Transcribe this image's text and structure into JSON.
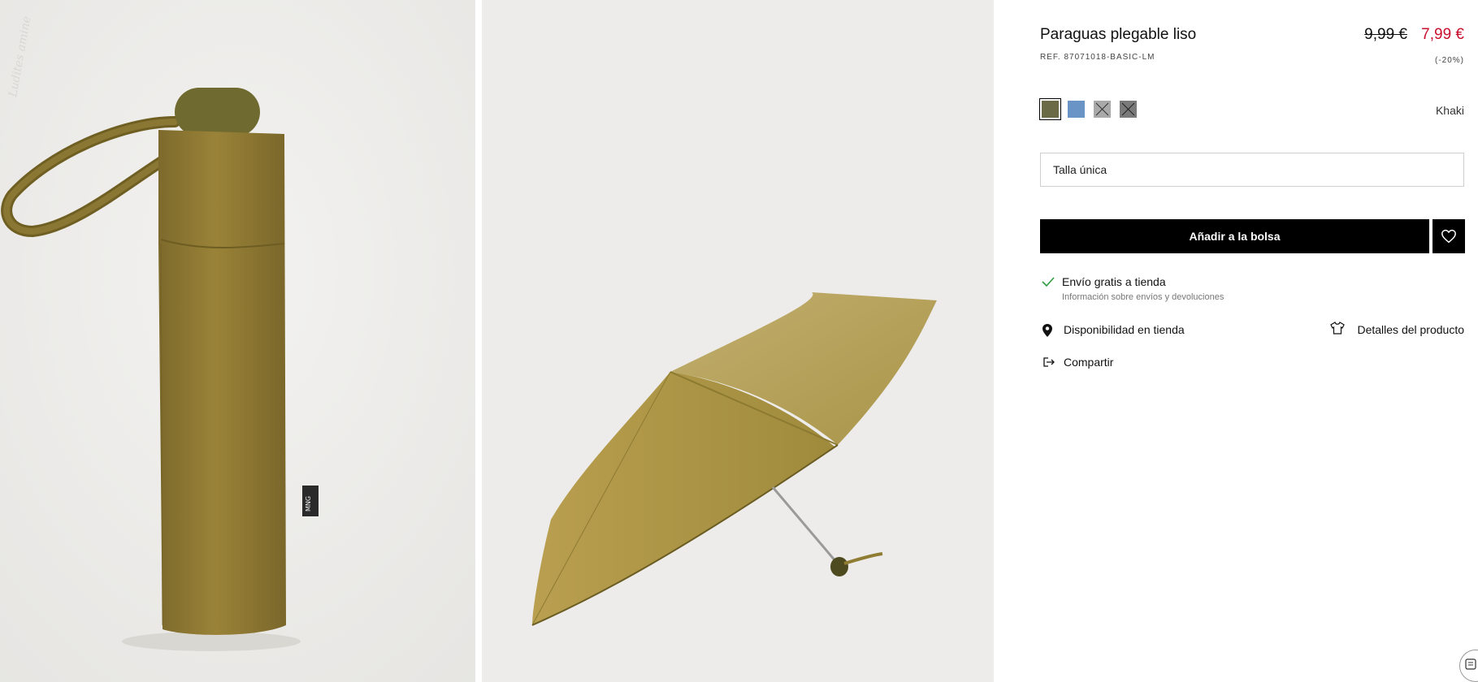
{
  "product": {
    "title": "Paraguas plegable liso",
    "ref": "REF. 87071018-BASIC-LM",
    "price_old": "9,99 €",
    "price_new": "7,99 €",
    "discount": "(-20%)",
    "selected_color": "Khaki"
  },
  "colors": {
    "swatches": [
      "#6b6a47",
      "#6a93c6",
      "#a9a9a9",
      "#7a7a7a"
    ],
    "accent_red": "#c8102e"
  },
  "size": {
    "label": "Talla única"
  },
  "actions": {
    "add_to_bag": "Añadir a la bolsa"
  },
  "shipping": {
    "title": "Envío gratis a tienda",
    "info_link": "Información sobre envíos y devoluciones"
  },
  "links": {
    "store_availability": "Disponibilidad en tienda",
    "product_details": "Detalles del producto",
    "share": "Compartir"
  },
  "gallery": {
    "watermark": "Ludites amine"
  }
}
